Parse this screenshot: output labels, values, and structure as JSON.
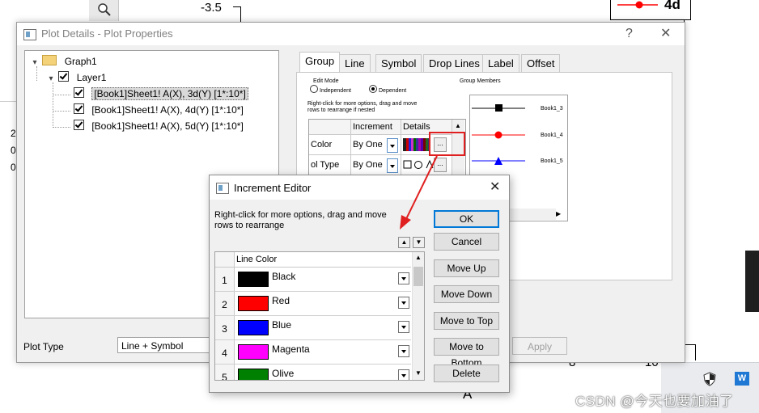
{
  "background": {
    "tick_top": "-3.5",
    "legend_label": "4d",
    "left_digits": [
      "2",
      "0",
      "0"
    ],
    "bottom_tick_8": "8",
    "bottom_tick_10": "10",
    "bottom_axis_letter": "A",
    "watermark": "CSDN @今天也要加油了"
  },
  "plot_details": {
    "title": "Plot Details - Plot Properties",
    "help": "?",
    "close": "✕",
    "tree": {
      "graph": "Graph1",
      "layer": "Layer1",
      "plots": [
        "[Book1]Sheet1! A(X), 3d(Y) [1*:10*]",
        "[Book1]Sheet1! A(X), 4d(Y) [1*:10*]",
        "[Book1]Sheet1! A(X), 5d(Y) [1*:10*]"
      ]
    },
    "plot_type_label": "Plot Type",
    "plot_type_value": "Line + Symbol",
    "apply": "Apply",
    "tabs": [
      "Group",
      "Line",
      "Symbol",
      "Drop Lines",
      "Label",
      "Offset"
    ],
    "group_tab": {
      "edit_mode": "Edit Mode",
      "independent": "Independent",
      "dependent": "Dependent",
      "hint_line1": "Right-click for more options, drag and move",
      "hint_line2": "rows to  rearrange if nested",
      "col_increment": "Increment",
      "col_details": "Details",
      "row1_label": "Color",
      "row1_value": "By One",
      "row2_label": "ol Type",
      "row2_value": "By One",
      "ellipsis": "...",
      "group_members": "Group Members",
      "members": [
        "Book1_3",
        "Book1_4",
        "Book1_5"
      ]
    }
  },
  "increment_editor": {
    "title": "Increment Editor",
    "close": "✕",
    "hint_line1": "Right-click for more options, drag and move",
    "hint_line2": "rows to  rearrange",
    "column_header": "Line Color",
    "rows": [
      {
        "num": "1",
        "name": "Black",
        "color": "#000000"
      },
      {
        "num": "2",
        "name": "Red",
        "color": "#ff0000"
      },
      {
        "num": "3",
        "name": "Blue",
        "color": "#0000ff"
      },
      {
        "num": "4",
        "name": "Magenta",
        "color": "#ff00ff"
      },
      {
        "num": "5",
        "name": "Olive",
        "color": "#008000"
      }
    ],
    "buttons": {
      "ok": "OK",
      "cancel": "Cancel",
      "move_up": "Move Up",
      "move_down": "Move Down",
      "move_top": "Move to Top",
      "move_bottom": "Move to Bottom",
      "delete": "Delete"
    }
  },
  "colors": {
    "red_highlight": "#e02020",
    "accent_blue": "#0078d7"
  }
}
